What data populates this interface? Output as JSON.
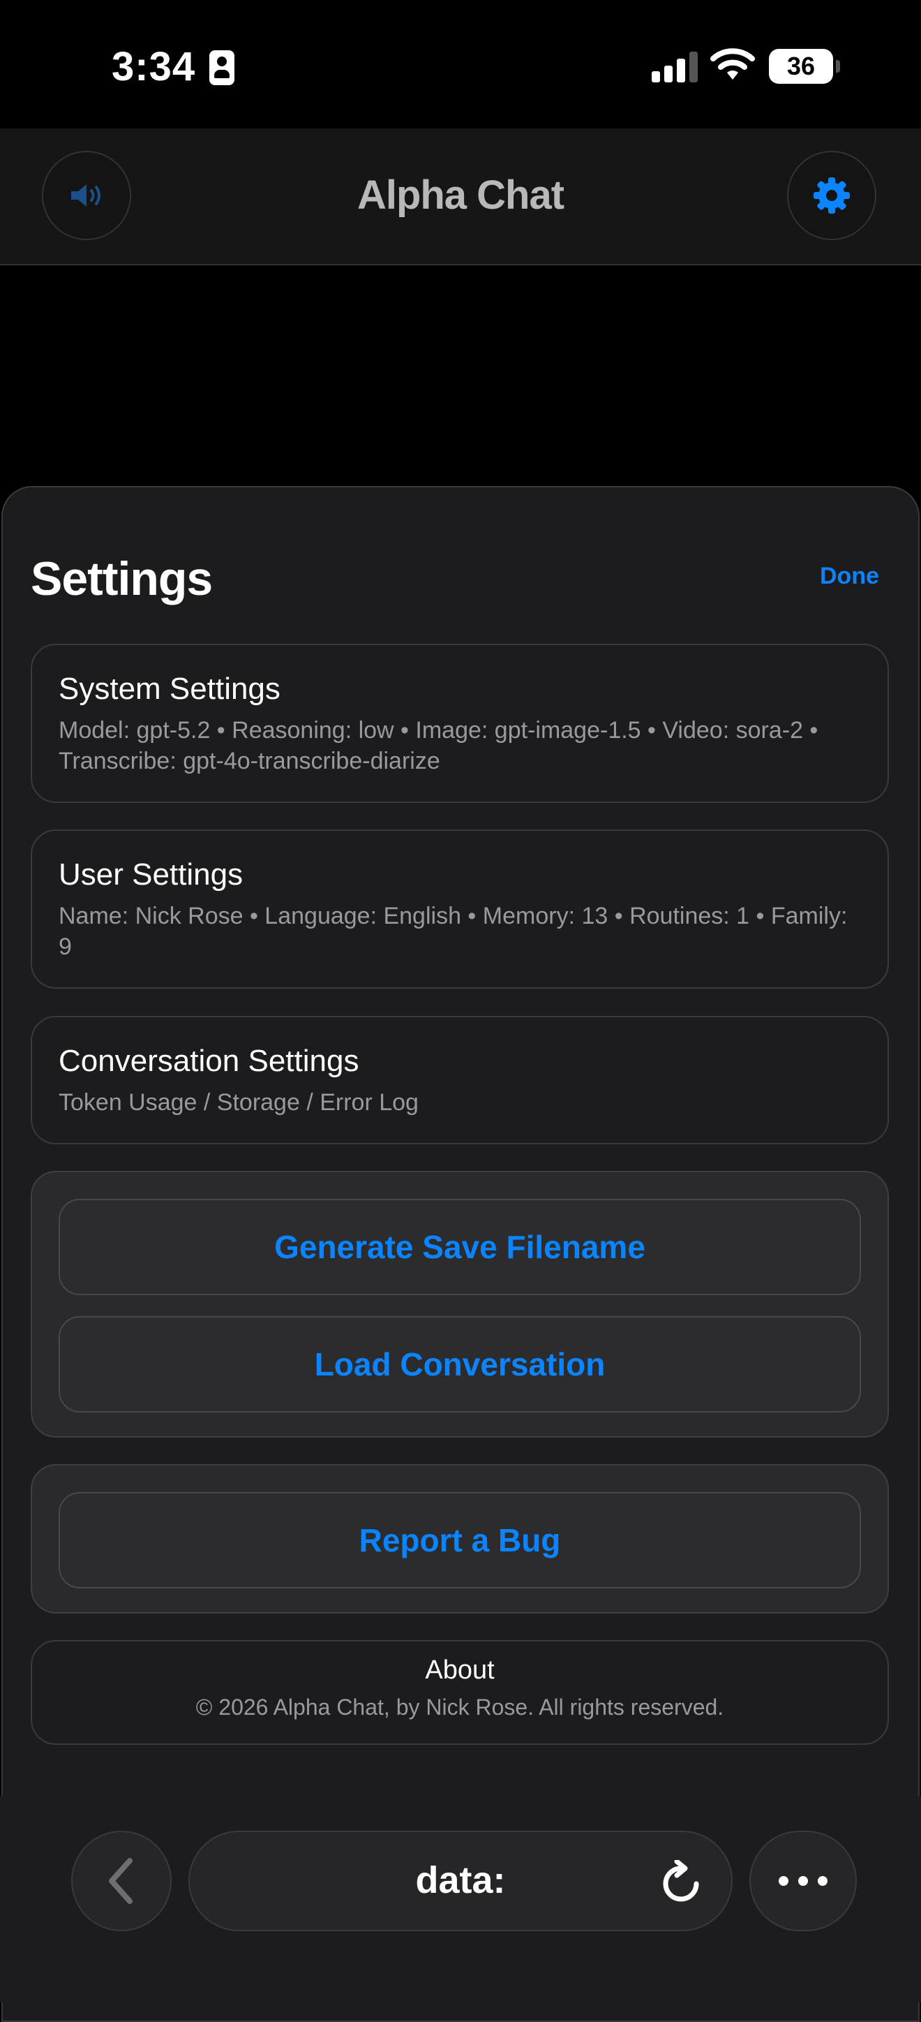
{
  "status_bar": {
    "time": "3:34",
    "battery": "36"
  },
  "app_bar": {
    "title": "Alpha Chat",
    "speaker_icon": "speaker-icon",
    "settings_icon": "gear-icon"
  },
  "sheet": {
    "title": "Settings",
    "done_label": "Done",
    "cards": [
      {
        "title": "System Settings",
        "subtitle": "Model: gpt-5.2 • Reasoning: low • Image: gpt-image-1.5 • Video: sora-2 • Transcribe: gpt-4o-transcribe-diarize"
      },
      {
        "title": "User Settings",
        "subtitle": "Name: Nick Rose • Language: English • Memory: 13 • Routines: 1 • Family: 9"
      },
      {
        "title": "Conversation Settings",
        "subtitle": "Token Usage / Storage / Error Log"
      }
    ],
    "actions": {
      "generate_save_filename": "Generate Save Filename",
      "load_conversation": "Load Conversation",
      "report_bug": "Report a Bug"
    },
    "about": {
      "title": "About",
      "copyright": "© 2026 Alpha Chat, by Nick Rose. All rights reserved."
    }
  },
  "browser": {
    "url": "data:"
  },
  "colors": {
    "accent": "#0a84ff",
    "background": "#000000",
    "sheet": "#1c1c1e"
  }
}
